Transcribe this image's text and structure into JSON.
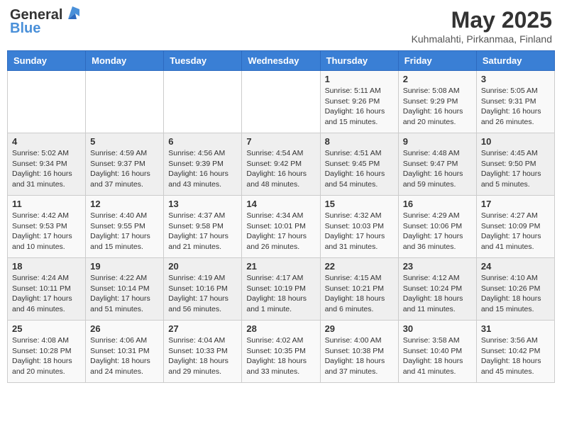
{
  "header": {
    "logo_general": "General",
    "logo_blue": "Blue",
    "month_title": "May 2025",
    "subtitle": "Kuhmalahti, Pirkanmaa, Finland"
  },
  "days_of_week": [
    "Sunday",
    "Monday",
    "Tuesday",
    "Wednesday",
    "Thursday",
    "Friday",
    "Saturday"
  ],
  "weeks": [
    [
      {
        "day": "",
        "info": ""
      },
      {
        "day": "",
        "info": ""
      },
      {
        "day": "",
        "info": ""
      },
      {
        "day": "",
        "info": ""
      },
      {
        "day": "1",
        "info": "Sunrise: 5:11 AM\nSunset: 9:26 PM\nDaylight: 16 hours\nand 15 minutes."
      },
      {
        "day": "2",
        "info": "Sunrise: 5:08 AM\nSunset: 9:29 PM\nDaylight: 16 hours\nand 20 minutes."
      },
      {
        "day": "3",
        "info": "Sunrise: 5:05 AM\nSunset: 9:31 PM\nDaylight: 16 hours\nand 26 minutes."
      }
    ],
    [
      {
        "day": "4",
        "info": "Sunrise: 5:02 AM\nSunset: 9:34 PM\nDaylight: 16 hours\nand 31 minutes."
      },
      {
        "day": "5",
        "info": "Sunrise: 4:59 AM\nSunset: 9:37 PM\nDaylight: 16 hours\nand 37 minutes."
      },
      {
        "day": "6",
        "info": "Sunrise: 4:56 AM\nSunset: 9:39 PM\nDaylight: 16 hours\nand 43 minutes."
      },
      {
        "day": "7",
        "info": "Sunrise: 4:54 AM\nSunset: 9:42 PM\nDaylight: 16 hours\nand 48 minutes."
      },
      {
        "day": "8",
        "info": "Sunrise: 4:51 AM\nSunset: 9:45 PM\nDaylight: 16 hours\nand 54 minutes."
      },
      {
        "day": "9",
        "info": "Sunrise: 4:48 AM\nSunset: 9:47 PM\nDaylight: 16 hours\nand 59 minutes."
      },
      {
        "day": "10",
        "info": "Sunrise: 4:45 AM\nSunset: 9:50 PM\nDaylight: 17 hours\nand 5 minutes."
      }
    ],
    [
      {
        "day": "11",
        "info": "Sunrise: 4:42 AM\nSunset: 9:53 PM\nDaylight: 17 hours\nand 10 minutes."
      },
      {
        "day": "12",
        "info": "Sunrise: 4:40 AM\nSunset: 9:55 PM\nDaylight: 17 hours\nand 15 minutes."
      },
      {
        "day": "13",
        "info": "Sunrise: 4:37 AM\nSunset: 9:58 PM\nDaylight: 17 hours\nand 21 minutes."
      },
      {
        "day": "14",
        "info": "Sunrise: 4:34 AM\nSunset: 10:01 PM\nDaylight: 17 hours\nand 26 minutes."
      },
      {
        "day": "15",
        "info": "Sunrise: 4:32 AM\nSunset: 10:03 PM\nDaylight: 17 hours\nand 31 minutes."
      },
      {
        "day": "16",
        "info": "Sunrise: 4:29 AM\nSunset: 10:06 PM\nDaylight: 17 hours\nand 36 minutes."
      },
      {
        "day": "17",
        "info": "Sunrise: 4:27 AM\nSunset: 10:09 PM\nDaylight: 17 hours\nand 41 minutes."
      }
    ],
    [
      {
        "day": "18",
        "info": "Sunrise: 4:24 AM\nSunset: 10:11 PM\nDaylight: 17 hours\nand 46 minutes."
      },
      {
        "day": "19",
        "info": "Sunrise: 4:22 AM\nSunset: 10:14 PM\nDaylight: 17 hours\nand 51 minutes."
      },
      {
        "day": "20",
        "info": "Sunrise: 4:19 AM\nSunset: 10:16 PM\nDaylight: 17 hours\nand 56 minutes."
      },
      {
        "day": "21",
        "info": "Sunrise: 4:17 AM\nSunset: 10:19 PM\nDaylight: 18 hours\nand 1 minute."
      },
      {
        "day": "22",
        "info": "Sunrise: 4:15 AM\nSunset: 10:21 PM\nDaylight: 18 hours\nand 6 minutes."
      },
      {
        "day": "23",
        "info": "Sunrise: 4:12 AM\nSunset: 10:24 PM\nDaylight: 18 hours\nand 11 minutes."
      },
      {
        "day": "24",
        "info": "Sunrise: 4:10 AM\nSunset: 10:26 PM\nDaylight: 18 hours\nand 15 minutes."
      }
    ],
    [
      {
        "day": "25",
        "info": "Sunrise: 4:08 AM\nSunset: 10:28 PM\nDaylight: 18 hours\nand 20 minutes."
      },
      {
        "day": "26",
        "info": "Sunrise: 4:06 AM\nSunset: 10:31 PM\nDaylight: 18 hours\nand 24 minutes."
      },
      {
        "day": "27",
        "info": "Sunrise: 4:04 AM\nSunset: 10:33 PM\nDaylight: 18 hours\nand 29 minutes."
      },
      {
        "day": "28",
        "info": "Sunrise: 4:02 AM\nSunset: 10:35 PM\nDaylight: 18 hours\nand 33 minutes."
      },
      {
        "day": "29",
        "info": "Sunrise: 4:00 AM\nSunset: 10:38 PM\nDaylight: 18 hours\nand 37 minutes."
      },
      {
        "day": "30",
        "info": "Sunrise: 3:58 AM\nSunset: 10:40 PM\nDaylight: 18 hours\nand 41 minutes."
      },
      {
        "day": "31",
        "info": "Sunrise: 3:56 AM\nSunset: 10:42 PM\nDaylight: 18 hours\nand 45 minutes."
      }
    ]
  ]
}
